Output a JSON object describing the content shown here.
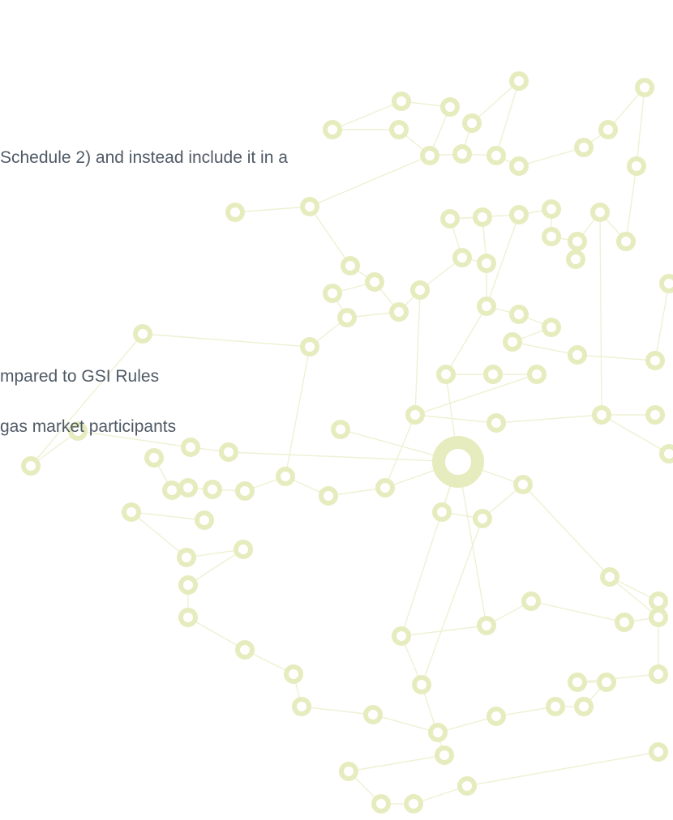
{
  "slide": {
    "lines": [
      "Schedule 2) and instead include it in a",
      "mpared to GSI Rules",
      "gas market participants"
    ]
  },
  "decoration": {
    "node_color": "#e7ecbf",
    "edge_color": "#eef1d3"
  }
}
